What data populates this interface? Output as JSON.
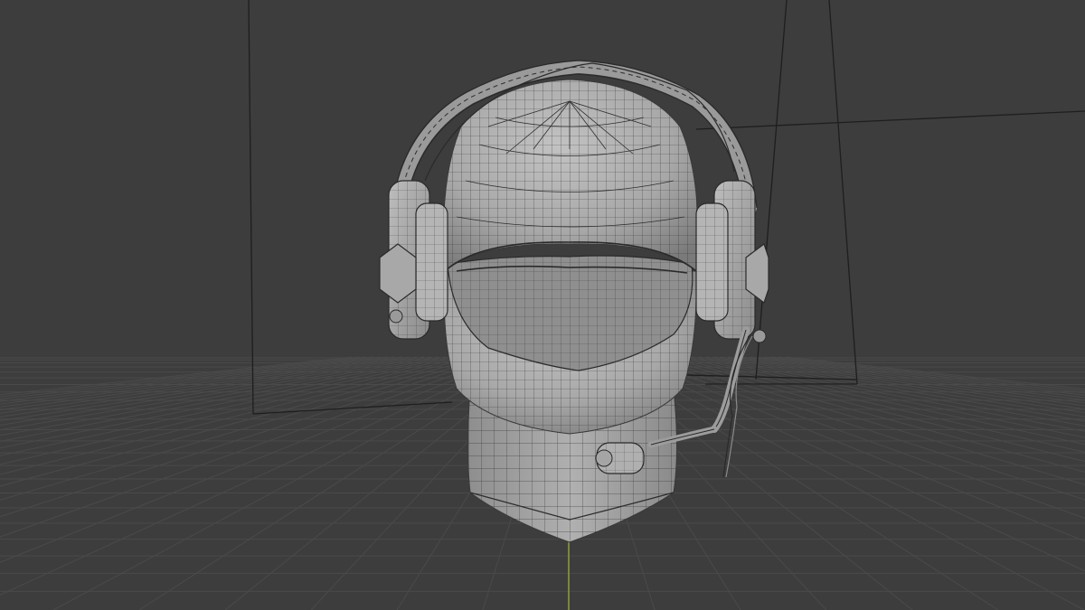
{
  "viewport": {
    "background_color": "#3d3d3d",
    "grid_color": "#4a4a4a",
    "mesh_fill_color": "#a7a7a7",
    "mesh_wire_color": "#2a2a2a",
    "camera_frame_color": "#1e1e1e",
    "y_axis_color": "#8fa03a"
  },
  "scene": {
    "object": "head-with-headset",
    "display_mode": "wireframe-overlay"
  }
}
